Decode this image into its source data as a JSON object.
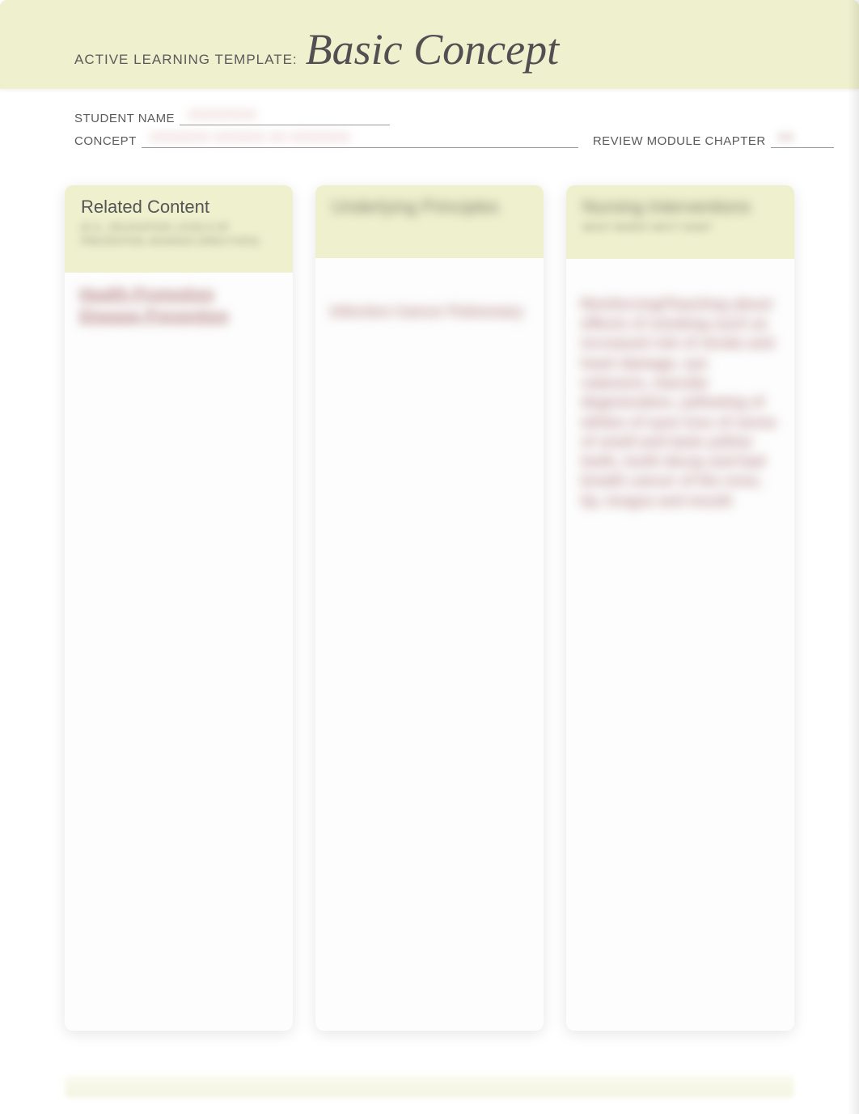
{
  "header": {
    "template_prefix": "ACTIVE LEARNING TEMPLATE:",
    "template_title": "Basic Concept"
  },
  "meta": {
    "student_label": "STUDENT NAME",
    "concept_label": "CONCEPT",
    "chapter_label": "REVIEW MODULE CHAPTER"
  },
  "columns": {
    "c1": {
      "title": "Related Content",
      "subtitle_blur": "(E.G., DELEGATION, LEVELS OF PREVENTION, ADVANCE DIRECTIVES)",
      "body_heading": "Health Promotion Disease Prevention"
    },
    "c2": {
      "title_blur": "Underlying Principles",
      "body_blur": "Infection Cancer Pulmonary"
    },
    "c3": {
      "title_blur": "Nursing Interventions",
      "subtitle_blur": "WHO? WHEN? WHY? HOW?",
      "body_blur": "Reinforcing/Teaching about effects of smoking such as increased risk of stroke and heart damage, eye cataracts, macular degeneration, yellowing of whites of eyes loss of sense of smell and taste yellow teeth, tooth decay and bad breath cancer of the nose, lip, tongue and mouth"
    }
  }
}
